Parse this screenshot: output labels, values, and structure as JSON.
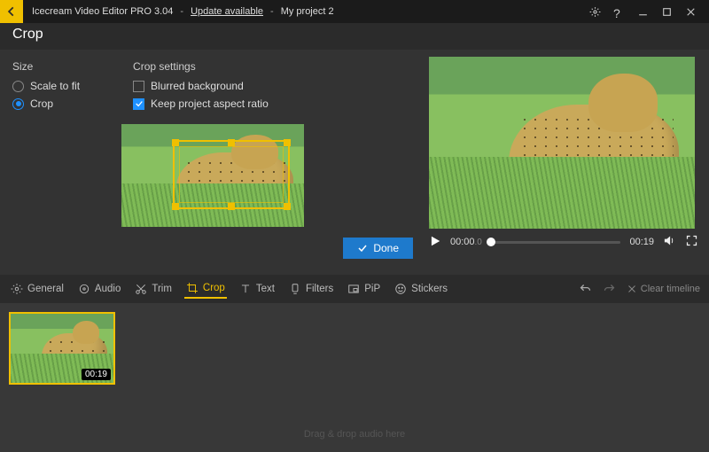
{
  "titlebar": {
    "app_title": "Icecream Video Editor PRO 3.04",
    "update_text": "Update available",
    "project_name": "My project 2",
    "sep": "-"
  },
  "header": {
    "title": "Crop"
  },
  "size_panel": {
    "heading": "Size",
    "opt_scale": "Scale to fit",
    "opt_crop": "Crop"
  },
  "settings_panel": {
    "heading": "Crop settings",
    "opt_blurred": "Blurred background",
    "opt_aspect": "Keep project aspect ratio"
  },
  "buttons": {
    "done": "Done"
  },
  "playback": {
    "current": "00:00",
    "current_frac": ".0",
    "duration": "00:19"
  },
  "tabs": {
    "general": "General",
    "audio": "Audio",
    "trim": "Trim",
    "crop": "Crop",
    "text": "Text",
    "filters": "Filters",
    "pip": "PiP",
    "stickers": "Stickers",
    "clear": "Clear timeline"
  },
  "timeline": {
    "clip_duration": "00:19",
    "audio_hint": "Drag & drop audio here"
  }
}
